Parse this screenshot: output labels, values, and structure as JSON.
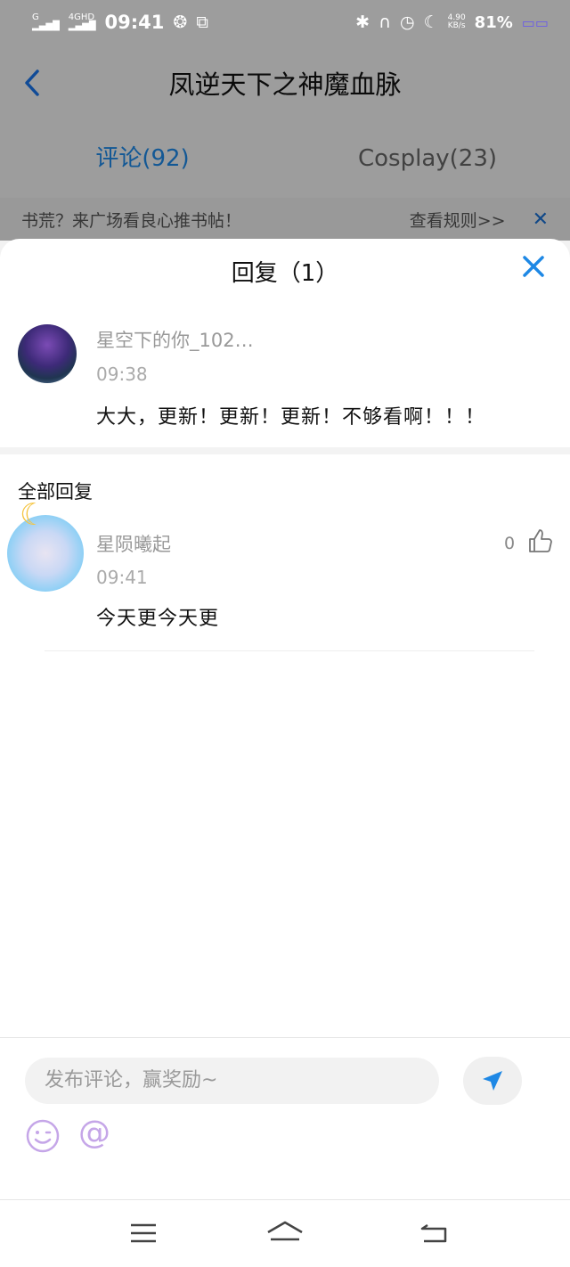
{
  "status_bar": {
    "signal_a": "G",
    "signal_b": "4GHD",
    "time": "09:41",
    "speed_value": "4.90",
    "speed_unit": "KB/s",
    "battery": "81%"
  },
  "nav": {
    "back_icon": "chevron-left-icon",
    "title": "凤逆天下之神魔血脉"
  },
  "tabs": [
    {
      "label": "评论(92)",
      "active": true
    },
    {
      "label": "Cosplay(23)",
      "active": false
    }
  ],
  "notice": {
    "text": "书荒？来广场看良心推书帖！",
    "rule_link": "查看规则>>",
    "close_icon": "close-icon"
  },
  "sheet": {
    "title": "回复（1）",
    "main_comment": {
      "author": "星空下的你_102…",
      "time": "09:38",
      "text": "大大，更新！更新！更新！不够看啊！！！"
    },
    "section_label": "全部回复",
    "replies": [
      {
        "author": "星陨曦起",
        "time": "09:41",
        "text": "今天更今天更",
        "likes": "0"
      }
    ]
  },
  "input_bar": {
    "placeholder": "发布评论，赢奖励~",
    "at_symbol": "@"
  },
  "colors": {
    "accent": "#1e88e5",
    "text_primary": "#111111",
    "text_secondary": "#999999"
  }
}
